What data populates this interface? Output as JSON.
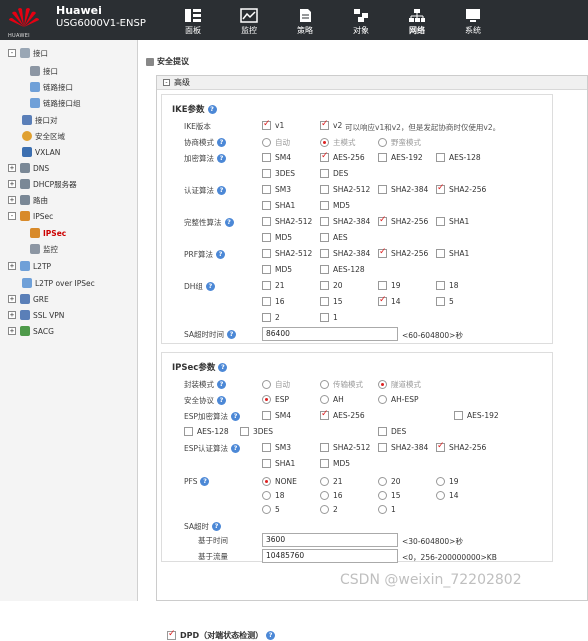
{
  "header": {
    "logo_text": "HUAWEI",
    "brand_name": "Huawei",
    "device_model": "USG6000V1-ENSP",
    "nav": [
      {
        "label": "面板",
        "icon": "dashboard-icon"
      },
      {
        "label": "监控",
        "icon": "monitor-icon"
      },
      {
        "label": "策略",
        "icon": "policy-icon"
      },
      {
        "label": "对象",
        "icon": "object-icon"
      },
      {
        "label": "网络",
        "icon": "network-icon"
      },
      {
        "label": "系统",
        "icon": "system-icon"
      }
    ],
    "active_nav": "网络"
  },
  "sidebar": {
    "items": [
      {
        "label": "接口",
        "expand": "-"
      },
      {
        "label": "接口"
      },
      {
        "label": "链路接口"
      },
      {
        "label": "链路接口组"
      },
      {
        "label": "接口对"
      },
      {
        "label": "安全区域"
      },
      {
        "label": "VXLAN"
      },
      {
        "label": "DNS",
        "expand": "+"
      },
      {
        "label": "DHCP服务器",
        "expand": "+"
      },
      {
        "label": "路由",
        "expand": "+"
      },
      {
        "label": "IPSec",
        "expand": "-"
      },
      {
        "label": "IPSec",
        "selected": true
      },
      {
        "label": "监控"
      },
      {
        "label": "L2TP",
        "expand": "+"
      },
      {
        "label": "L2TP over IPSec"
      },
      {
        "label": "GRE",
        "expand": "+"
      },
      {
        "label": "SSL VPN",
        "expand": "+"
      },
      {
        "label": "SACG",
        "expand": "+"
      }
    ]
  },
  "breadcrumb": "安全提议",
  "advanced_label": "高级",
  "ike": {
    "title": "IKE参数",
    "version_label": "IKE版本",
    "v1": "v1",
    "v2": "v2",
    "version_note": "可以响应v1和v2，但是发起协商时仅使用v2。",
    "mode_label": "协商模式",
    "modes": [
      "自动",
      "主模式",
      "野蛮模式"
    ],
    "enc_label": "加密算法",
    "enc": [
      "SM4",
      "AES-256",
      "AES-192",
      "AES-128",
      "3DES",
      "DES"
    ],
    "auth_label": "认证算法",
    "auth": [
      "SM3",
      "SHA2-512",
      "SHA2-384",
      "SHA2-256",
      "SHA1",
      "MD5"
    ],
    "integ_label": "完整性算法",
    "integ": [
      "SHA2-512",
      "SHA2-384",
      "SHA2-256",
      "SHA1",
      "MD5",
      "AES"
    ],
    "prf_label": "PRF算法",
    "prf": [
      "SHA2-512",
      "SHA2-384",
      "SHA2-256",
      "SHA1",
      "MD5",
      "AES-128"
    ],
    "dh_label": "DH组",
    "dh": [
      "21",
      "20",
      "19",
      "18",
      "16",
      "15",
      "14",
      "5",
      "2",
      "1"
    ],
    "sa_label": "SA超时时间",
    "sa_value": "86400",
    "sa_hint": "<60-604800>秒"
  },
  "ipsec": {
    "title": "IPSec参数",
    "encap_label": "封装模式",
    "encap": [
      "自动",
      "传输模式",
      "隧道模式"
    ],
    "proto_label": "安全协议",
    "proto": [
      "ESP",
      "AH",
      "AH-ESP"
    ],
    "esp_enc_label": "ESP加密算法",
    "esp_enc": [
      "SM4",
      "AES-256",
      "AES-192",
      "AES-128",
      "3DES",
      "DES"
    ],
    "esp_auth_label": "ESP认证算法",
    "esp_auth": [
      "SM3",
      "SHA2-512",
      "SHA2-384",
      "SHA2-256",
      "SHA1",
      "MD5"
    ],
    "pfs_label": "PFS",
    "pfs": [
      "NONE",
      "21",
      "20",
      "19",
      "18",
      "16",
      "15",
      "14",
      "5",
      "2",
      "1"
    ],
    "sa_label": "SA超时",
    "time_label": "基于时间",
    "time_value": "3600",
    "time_hint": "<30-604800>秒",
    "traffic_label": "基于流量",
    "traffic_value": "10485760",
    "traffic_hint": "<0，256-200000000>KB"
  },
  "dpd_label": "DPD（对端状态检测）",
  "watermark": "CSDN @weixin_72202802",
  "colors": {
    "topbar": "#2b2f33",
    "accent_red": "#d22222",
    "help_blue": "#4c88d6"
  }
}
